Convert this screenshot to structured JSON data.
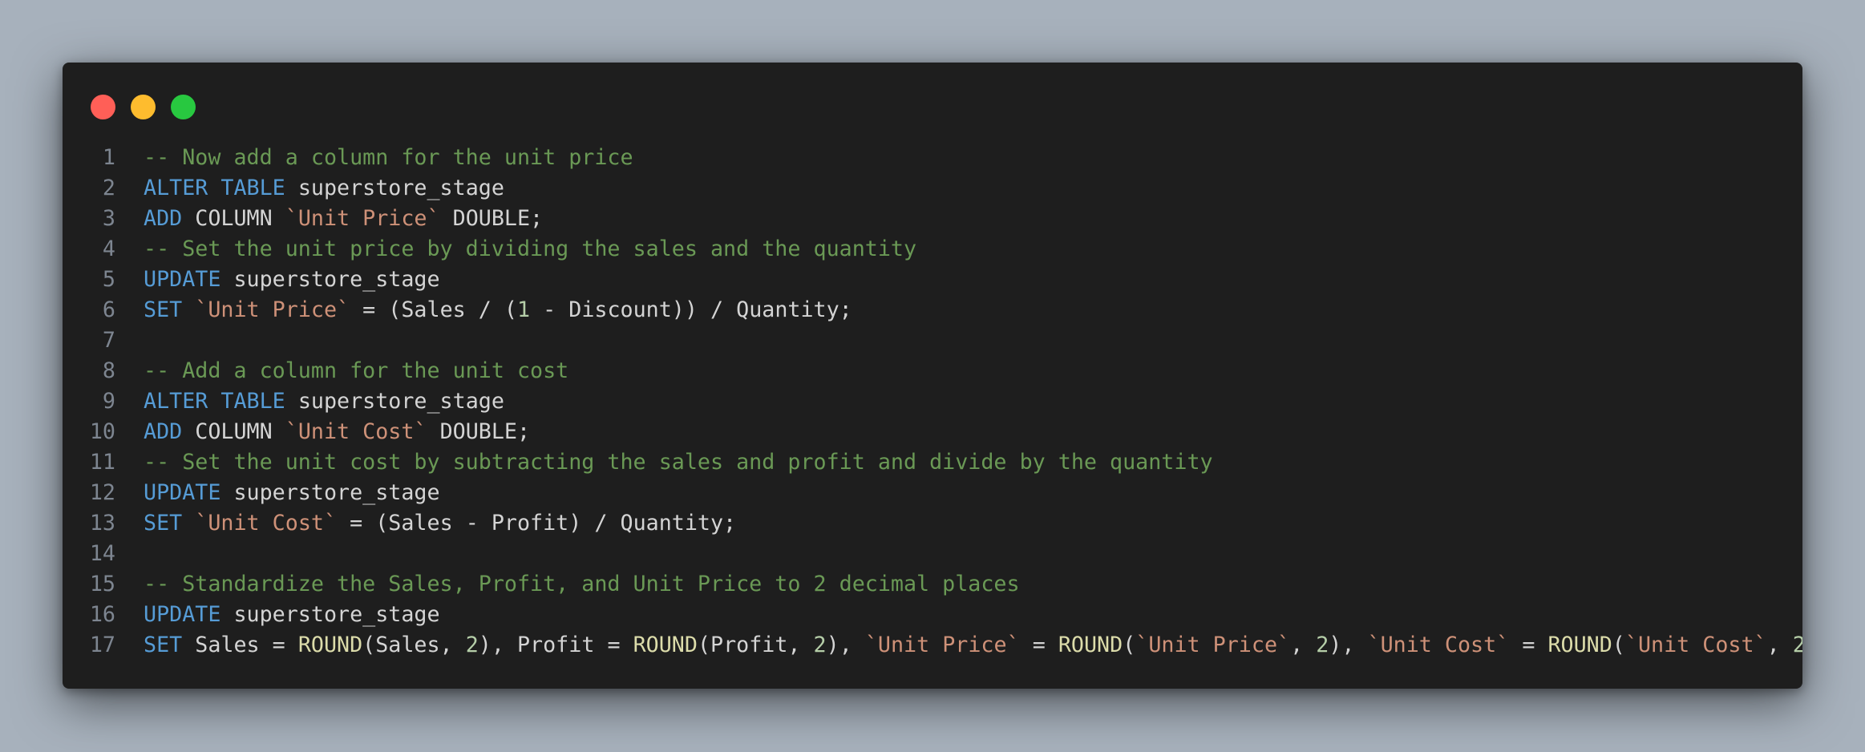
{
  "window": {
    "traffic_lights": [
      {
        "name": "close-dot",
        "color": "#ff5f57"
      },
      {
        "name": "minimize-dot",
        "color": "#febc2e"
      },
      {
        "name": "zoom-dot",
        "color": "#28c840"
      }
    ]
  },
  "colors": {
    "comment": "#6a9955",
    "keyword": "#569cd6",
    "identifier": "#d4d4d4",
    "string": "#ce9178",
    "number": "#b5cea8",
    "function": "#dcdcaa",
    "line_number": "#7d8590",
    "background": "#1e1e1e"
  },
  "code": {
    "lines": [
      {
        "number": "1",
        "tokens": [
          {
            "t": "comment",
            "v": "-- Now add a column for the unit price"
          }
        ]
      },
      {
        "number": "2",
        "tokens": [
          {
            "t": "keyword",
            "v": "ALTER TABLE"
          },
          {
            "t": "ident",
            "v": " superstore_stage"
          }
        ]
      },
      {
        "number": "3",
        "tokens": [
          {
            "t": "keyword",
            "v": "ADD"
          },
          {
            "t": "ident",
            "v": " COLUMN "
          },
          {
            "t": "string",
            "v": "`Unit Price`"
          },
          {
            "t": "ident",
            "v": " DOUBLE;"
          }
        ]
      },
      {
        "number": "4",
        "tokens": [
          {
            "t": "comment",
            "v": "-- Set the unit price by dividing the sales and the quantity"
          }
        ]
      },
      {
        "number": "5",
        "tokens": [
          {
            "t": "keyword",
            "v": "UPDATE"
          },
          {
            "t": "ident",
            "v": " superstore_stage"
          }
        ]
      },
      {
        "number": "6",
        "tokens": [
          {
            "t": "keyword",
            "v": "SET"
          },
          {
            "t": "ident",
            "v": " "
          },
          {
            "t": "string",
            "v": "`Unit Price`"
          },
          {
            "t": "ident",
            "v": " = (Sales / ("
          },
          {
            "t": "number",
            "v": "1"
          },
          {
            "t": "ident",
            "v": " - Discount)) / Quantity;"
          }
        ]
      },
      {
        "number": "7",
        "tokens": []
      },
      {
        "number": "8",
        "tokens": [
          {
            "t": "comment",
            "v": "-- Add a column for the unit cost"
          }
        ]
      },
      {
        "number": "9",
        "tokens": [
          {
            "t": "keyword",
            "v": "ALTER TABLE"
          },
          {
            "t": "ident",
            "v": " superstore_stage"
          }
        ]
      },
      {
        "number": "10",
        "tokens": [
          {
            "t": "keyword",
            "v": "ADD"
          },
          {
            "t": "ident",
            "v": " COLUMN "
          },
          {
            "t": "string",
            "v": "`Unit Cost`"
          },
          {
            "t": "ident",
            "v": " DOUBLE;"
          }
        ]
      },
      {
        "number": "11",
        "tokens": [
          {
            "t": "comment",
            "v": "-- Set the unit cost by subtracting the sales and profit and divide by the quantity"
          }
        ]
      },
      {
        "number": "12",
        "tokens": [
          {
            "t": "keyword",
            "v": "UPDATE"
          },
          {
            "t": "ident",
            "v": " superstore_stage"
          }
        ]
      },
      {
        "number": "13",
        "tokens": [
          {
            "t": "keyword",
            "v": "SET"
          },
          {
            "t": "ident",
            "v": " "
          },
          {
            "t": "string",
            "v": "`Unit Cost`"
          },
          {
            "t": "ident",
            "v": " = (Sales - Profit) / Quantity;"
          }
        ]
      },
      {
        "number": "14",
        "tokens": []
      },
      {
        "number": "15",
        "tokens": [
          {
            "t": "comment",
            "v": "-- Standardize the Sales, Profit, and Unit Price to 2 decimal places"
          }
        ]
      },
      {
        "number": "16",
        "tokens": [
          {
            "t": "keyword",
            "v": "UPDATE"
          },
          {
            "t": "ident",
            "v": " superstore_stage"
          }
        ]
      },
      {
        "number": "17",
        "tokens": [
          {
            "t": "keyword",
            "v": "SET"
          },
          {
            "t": "ident",
            "v": " Sales = "
          },
          {
            "t": "function",
            "v": "ROUND"
          },
          {
            "t": "ident",
            "v": "(Sales, "
          },
          {
            "t": "number",
            "v": "2"
          },
          {
            "t": "ident",
            "v": "), Profit = "
          },
          {
            "t": "function",
            "v": "ROUND"
          },
          {
            "t": "ident",
            "v": "(Profit, "
          },
          {
            "t": "number",
            "v": "2"
          },
          {
            "t": "ident",
            "v": "), "
          },
          {
            "t": "string",
            "v": "`Unit Price`"
          },
          {
            "t": "ident",
            "v": " = "
          },
          {
            "t": "function",
            "v": "ROUND"
          },
          {
            "t": "ident",
            "v": "("
          },
          {
            "t": "string",
            "v": "`Unit Price`"
          },
          {
            "t": "ident",
            "v": ", "
          },
          {
            "t": "number",
            "v": "2"
          },
          {
            "t": "ident",
            "v": "), "
          },
          {
            "t": "string",
            "v": "`Unit Cost`"
          },
          {
            "t": "ident",
            "v": " = "
          },
          {
            "t": "function",
            "v": "ROUND"
          },
          {
            "t": "ident",
            "v": "("
          },
          {
            "t": "string",
            "v": "`Unit Cost`"
          },
          {
            "t": "ident",
            "v": ", "
          },
          {
            "t": "number",
            "v": "2"
          },
          {
            "t": "ident",
            "v": ");"
          }
        ]
      }
    ]
  }
}
